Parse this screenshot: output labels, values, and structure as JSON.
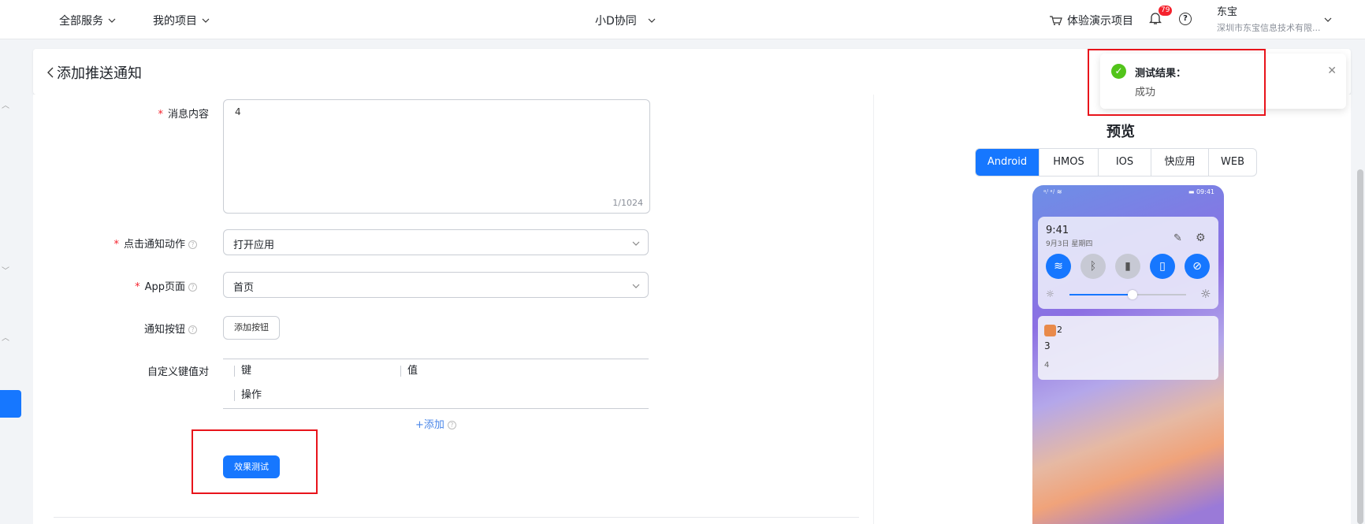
{
  "topnav": {
    "all_services": "全部服务",
    "my_projects": "我的项目",
    "workspace": "小D协同",
    "demo_project": "体验演示项目",
    "notifications_count": "79",
    "help": "?",
    "user_name": "东宝",
    "user_org": "深圳市东宝信息技术有限..."
  },
  "page": {
    "title": "添加推送通知"
  },
  "form": {
    "message_content_label": "消息内容",
    "message_content_value": "4",
    "message_content_count": "1/1024",
    "click_action_label": "点击通知动作",
    "click_action_value": "打开应用",
    "app_page_label": "App页面",
    "app_page_value": "首页",
    "notify_button_label": "通知按钮",
    "add_button_label": "添加按钮",
    "kv_label": "自定义键值对",
    "kv_columns": {
      "key": "键",
      "value": "值",
      "action": "操作"
    },
    "add_link": "+添加",
    "test_button": "效果测试"
  },
  "preview": {
    "title": "预览",
    "tabs": [
      "Android",
      "HMOS",
      "IOS",
      "快应用",
      "WEB"
    ],
    "active_tab": "Android",
    "phone": {
      "status_left": "ᵃᵢˡ ᵃᵢˡ ≋",
      "status_right": "▬ 09:41",
      "time": "9:41",
      "date": "9月3日 星期四",
      "notification_title": "2",
      "notification_body": "3",
      "notification_content": "4"
    }
  },
  "toast": {
    "title": "测试结果：",
    "body": "成功"
  },
  "colors": {
    "primary": "#1677ff",
    "success": "#52c41a",
    "highlight_box": "#e8141b"
  }
}
